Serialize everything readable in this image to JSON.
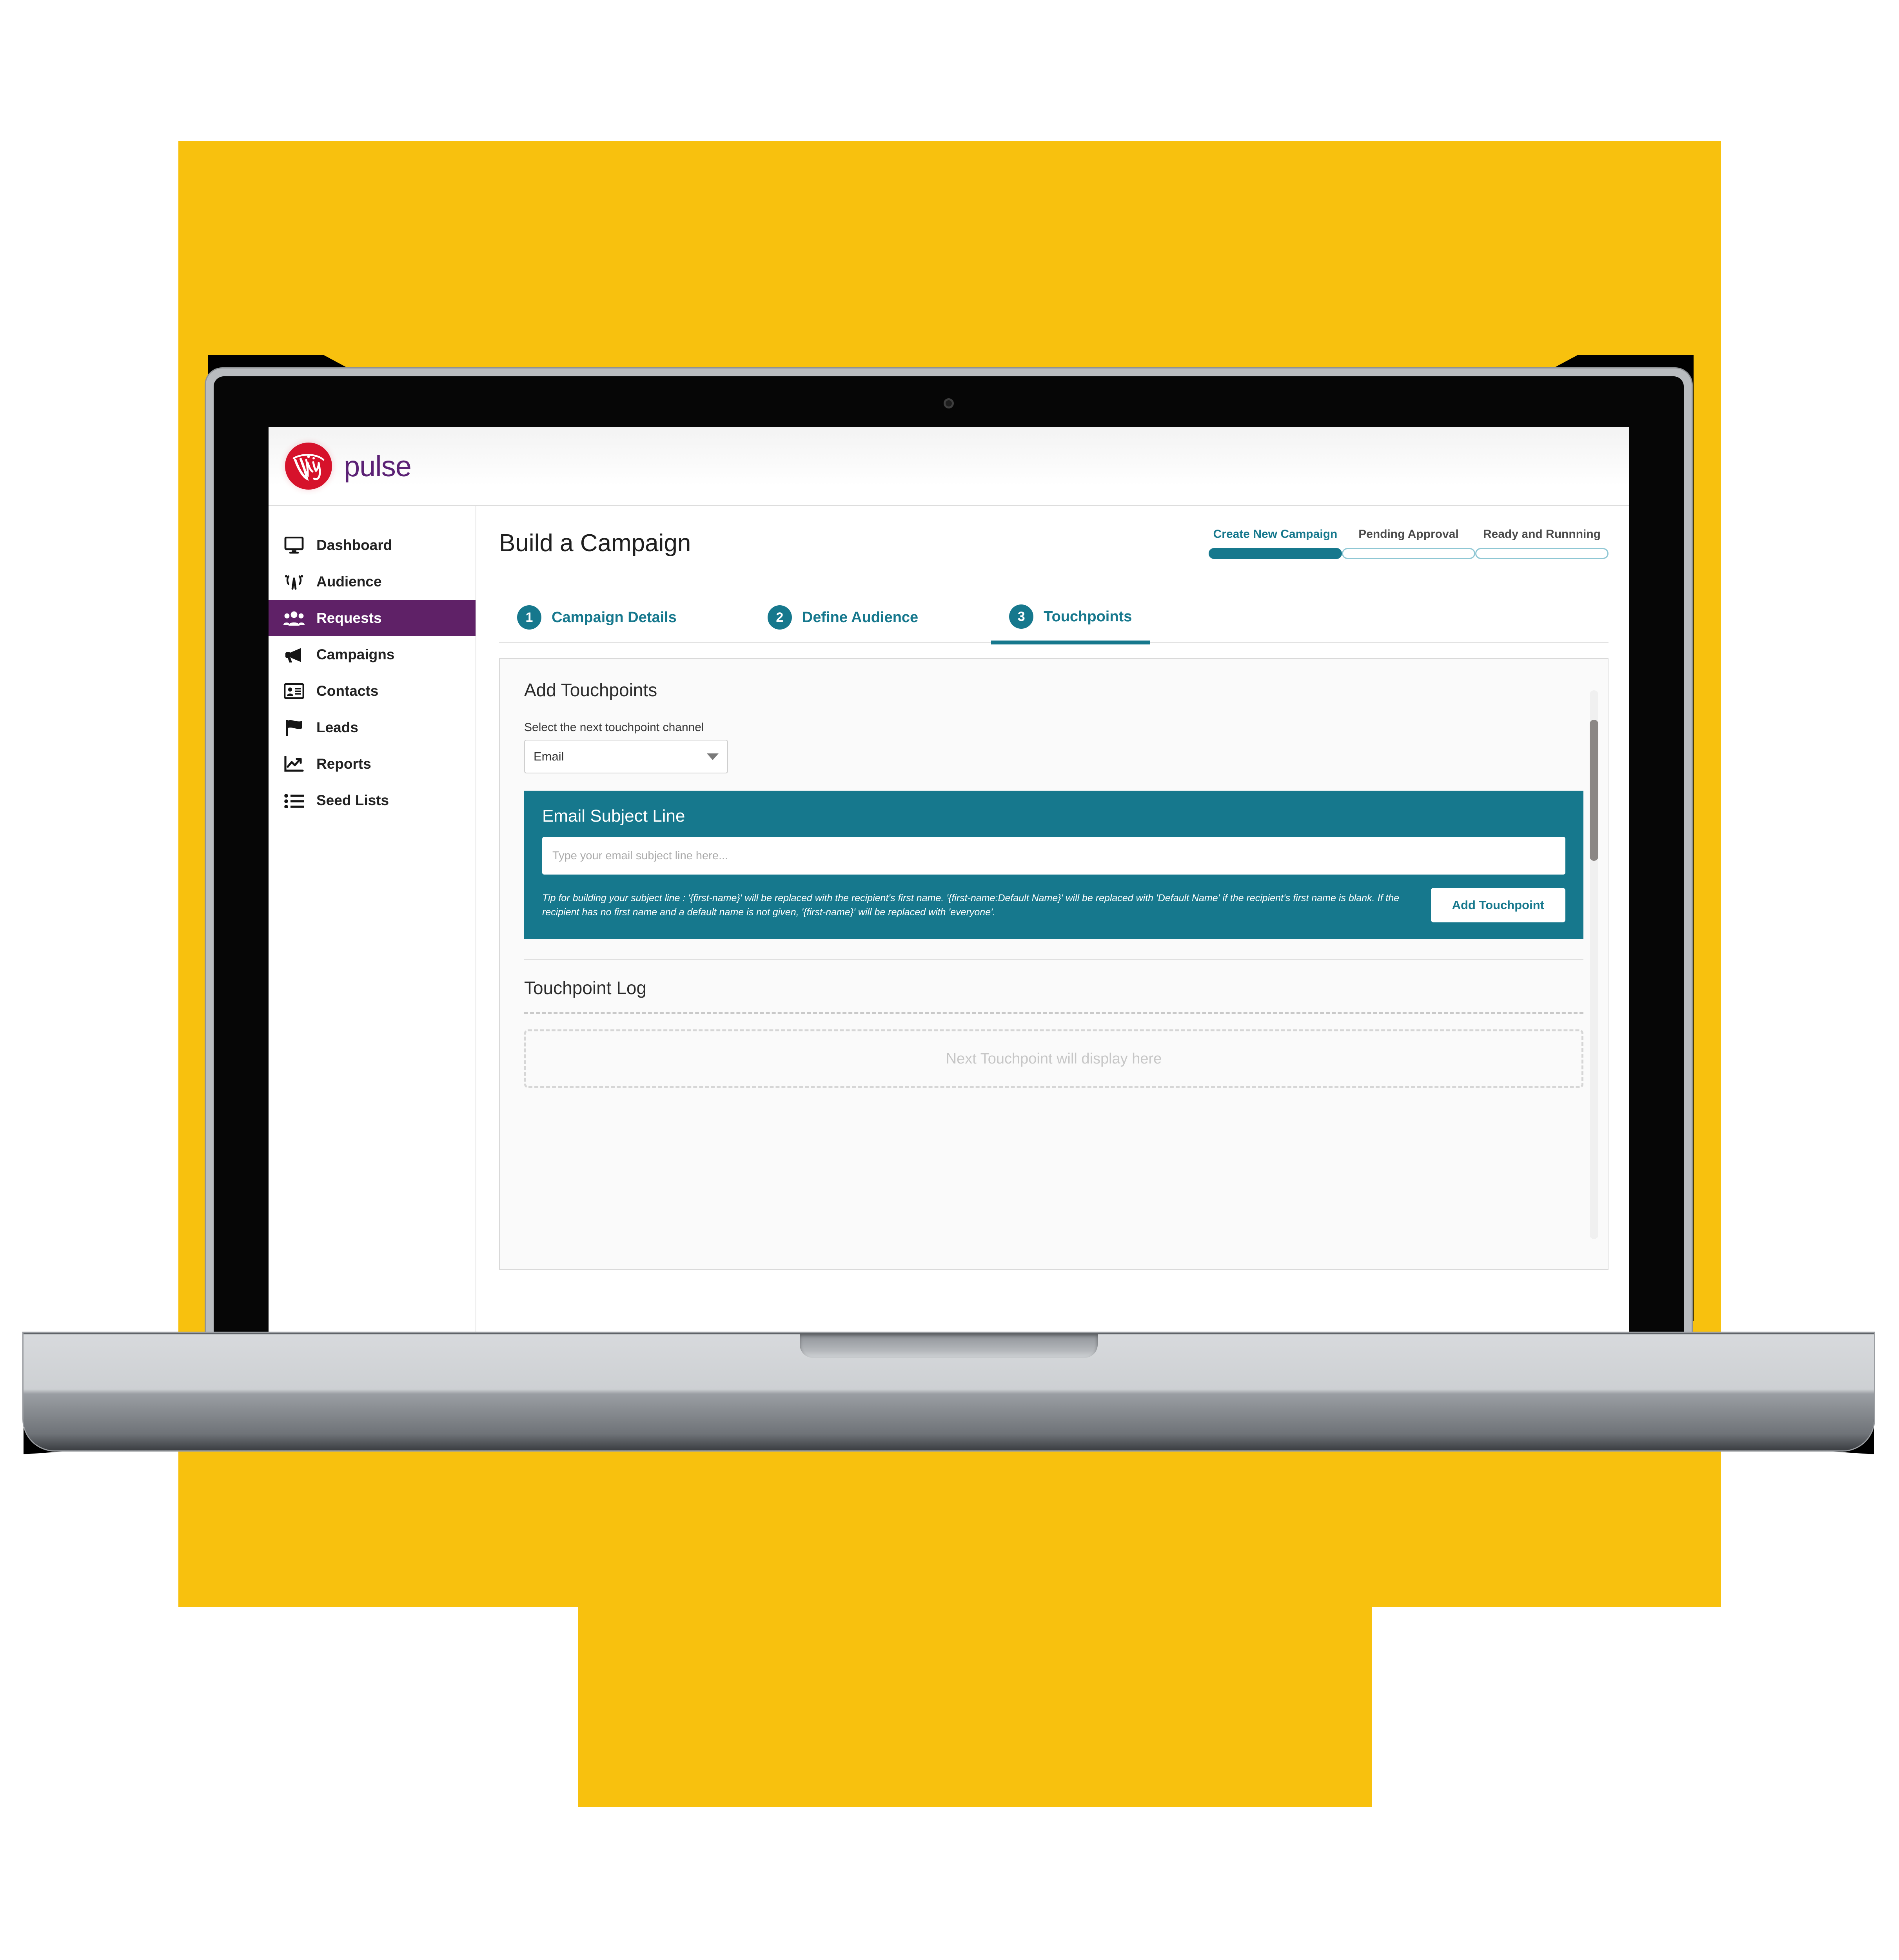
{
  "brand": {
    "logo_mark": "virgin-circle-logo",
    "logo_word": "pulse",
    "colors": {
      "yellow": "#F8C10E",
      "teal": "#16788D",
      "purple": "#5F2167",
      "virgin_red": "#D6122B",
      "pulse_purple": "#5B2175"
    }
  },
  "sidebar": {
    "items": [
      {
        "label": "Dashboard",
        "icon": "monitor-icon",
        "active": false
      },
      {
        "label": "Audience",
        "icon": "broadcast-icon",
        "active": false
      },
      {
        "label": "Requests",
        "icon": "people-icon",
        "active": true
      },
      {
        "label": "Campaigns",
        "icon": "megaphone-icon",
        "active": false
      },
      {
        "label": "Contacts",
        "icon": "id-card-icon",
        "active": false
      },
      {
        "label": "Leads",
        "icon": "flag-icon",
        "active": false
      },
      {
        "label": "Reports",
        "icon": "chart-line-icon",
        "active": false
      },
      {
        "label": "Seed Lists",
        "icon": "list-icon",
        "active": false
      }
    ]
  },
  "header": {
    "page_title": "Build a Campaign"
  },
  "stages": [
    {
      "label": "Create New Campaign",
      "state": "active"
    },
    {
      "label": "Pending Approval",
      "state": "upcoming"
    },
    {
      "label": "Ready and Runnning",
      "state": "upcoming"
    }
  ],
  "steps": [
    {
      "number": "1",
      "label": "Campaign Details",
      "active": false
    },
    {
      "number": "2",
      "label": "Define Audience",
      "active": false
    },
    {
      "number": "3",
      "label": "Touchpoints",
      "active": true
    }
  ],
  "add_touchpoints": {
    "section_title": "Add Touchpoints",
    "channel_field_label": "Select the next touchpoint channel",
    "channel_selected": "Email",
    "channel_caret": "chevron-down-icon"
  },
  "email_panel": {
    "title": "Email Subject Line",
    "subject_placeholder": "Type your email subject line here...",
    "subject_value": "",
    "tip": "Tip for building your subject line : '{first-name}' will be replaced with the recipient's first name. '{first-name:Default Name}' will be replaced with 'Default Name' if the recipient's first name is blank. If the recipient has no first name and a default name is not given, '{first-name}' will be replaced with 'everyone'.",
    "add_button": "Add Touchpoint"
  },
  "touchpoint_log": {
    "title": "Touchpoint Log",
    "empty_message": "Next Touchpoint will display here"
  }
}
